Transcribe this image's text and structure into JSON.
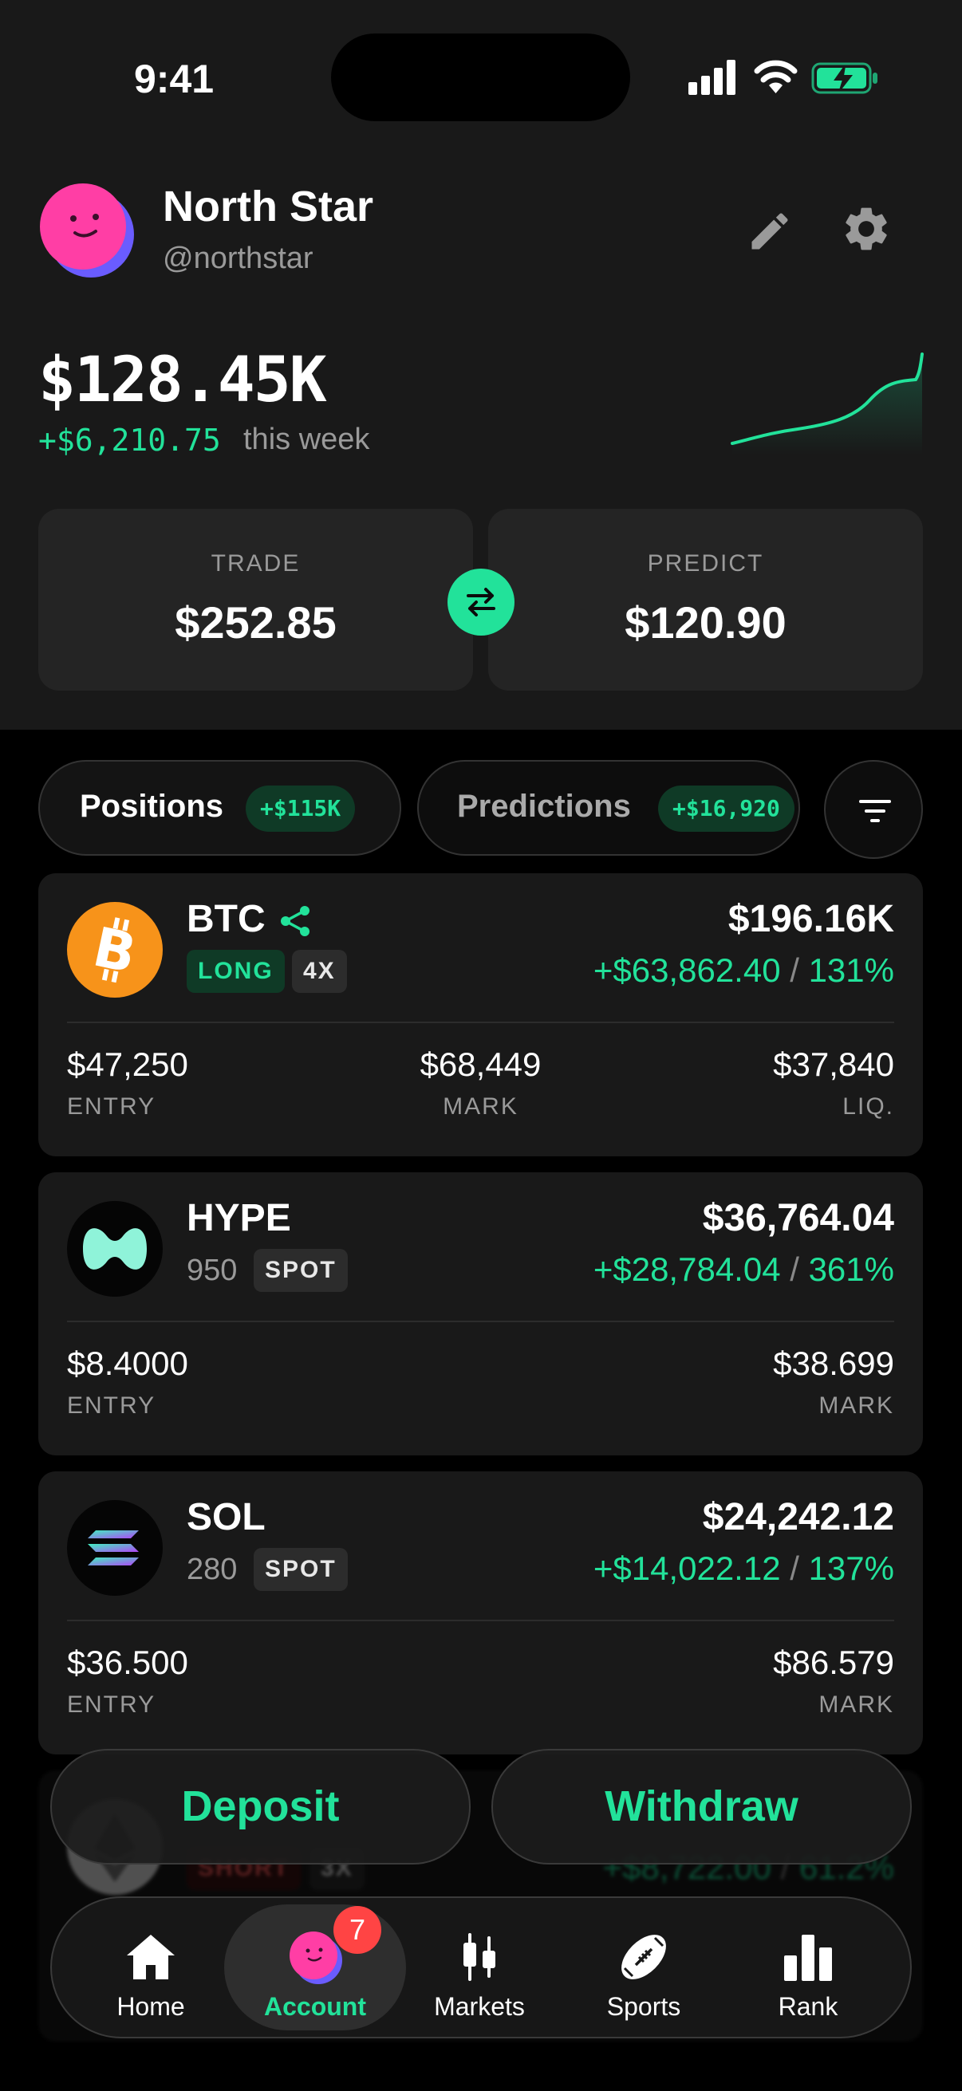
{
  "status_bar": {
    "time": "9:41"
  },
  "profile": {
    "name": "North Star",
    "handle": "@northstar"
  },
  "portfolio": {
    "balance": "$128.45K",
    "week_gain": "+$6,210.75",
    "week_label": "this week",
    "accent_color": "#22e29a"
  },
  "balances": {
    "trade_label": "TRADE",
    "trade_value": "$252.85",
    "predict_label": "PREDICT",
    "predict_value": "$120.90"
  },
  "tabs": [
    {
      "label": "Positions",
      "badge": "+$115K",
      "active": true
    },
    {
      "label": "Predictions",
      "badge": "+$16,920",
      "active": false
    }
  ],
  "positions": [
    {
      "symbol": "BTC",
      "icon": "bitcoin-icon",
      "side": "LONG",
      "leverage": "4X",
      "value": "$196.16K",
      "pnl": "+$63,862.40",
      "pnl_sep": "/",
      "pnl_pct": "131%",
      "stats": [
        {
          "value": "$47,250",
          "label": "ENTRY"
        },
        {
          "value": "$68,449",
          "label": "MARK"
        },
        {
          "value": "$37,840",
          "label": "LIQ."
        }
      ]
    },
    {
      "symbol": "HYPE",
      "icon": "hype-icon",
      "size": "950",
      "type": "SPOT",
      "value": "$36,764.04",
      "pnl": "+$28,784.04",
      "pnl_sep": "/",
      "pnl_pct": "361%",
      "stats": [
        {
          "value": "$8.4000",
          "label": "ENTRY"
        },
        {
          "value": "$38.699",
          "label": "MARK"
        }
      ]
    },
    {
      "symbol": "SOL",
      "icon": "solana-icon",
      "size": "280",
      "type": "SPOT",
      "value": "$24,242.12",
      "pnl": "+$14,022.12",
      "pnl_sep": "/",
      "pnl_pct": "137%",
      "stats": [
        {
          "value": "$36.500",
          "label": "ENTRY"
        },
        {
          "value": "$86.579",
          "label": "MARK"
        }
      ]
    },
    {
      "icon": "ethereum-icon",
      "side": "SHORT",
      "leverage": "3X",
      "pnl": "+$8,722.00",
      "pnl_sep": "/",
      "pnl_pct": "61.2%"
    }
  ],
  "actions": {
    "deposit": "Deposit",
    "withdraw": "Withdraw"
  },
  "nav": [
    {
      "label": "Home",
      "icon": "home-icon"
    },
    {
      "label": "Account",
      "icon": "avatar-icon",
      "badge": "7",
      "active": true
    },
    {
      "label": "Markets",
      "icon": "candlestick-icon"
    },
    {
      "label": "Sports",
      "icon": "football-icon"
    },
    {
      "label": "Rank",
      "icon": "bar-chart-icon"
    }
  ]
}
